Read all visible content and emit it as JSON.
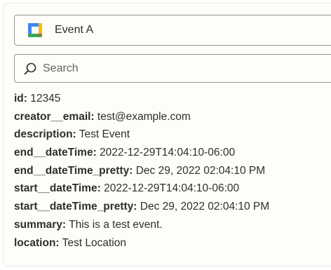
{
  "event": {
    "label": "Event A",
    "icon": "google-calendar-icon"
  },
  "search": {
    "placeholder": "Search",
    "value": ""
  },
  "fields": [
    {
      "key": "id:",
      "value": "12345"
    },
    {
      "key": "creator__email:",
      "value": "test@example.com"
    },
    {
      "key": "description:",
      "value": "Test Event"
    },
    {
      "key": "end__dateTime:",
      "value": "2022-12-29T14:04:10-06:00"
    },
    {
      "key": "end__dateTime_pretty:",
      "value": "Dec 29, 2022 02:04:10 PM"
    },
    {
      "key": "start__dateTime:",
      "value": "2022-12-29T14:04:10-06:00"
    },
    {
      "key": "start__dateTime_pretty:",
      "value": "Dec 29, 2022 02:04:10 PM"
    },
    {
      "key": "summary:",
      "value": "This is a test event."
    },
    {
      "key": "location:",
      "value": "Test Location"
    }
  ],
  "colors": {
    "panel_bg": "#fffdf9",
    "border": "#95928e",
    "text": "#2d2e2e",
    "gcal_blue": "#4285f4",
    "gcal_green": "#34a853",
    "gcal_yellow": "#fbbc04",
    "gcal_red": "#ea4335"
  }
}
